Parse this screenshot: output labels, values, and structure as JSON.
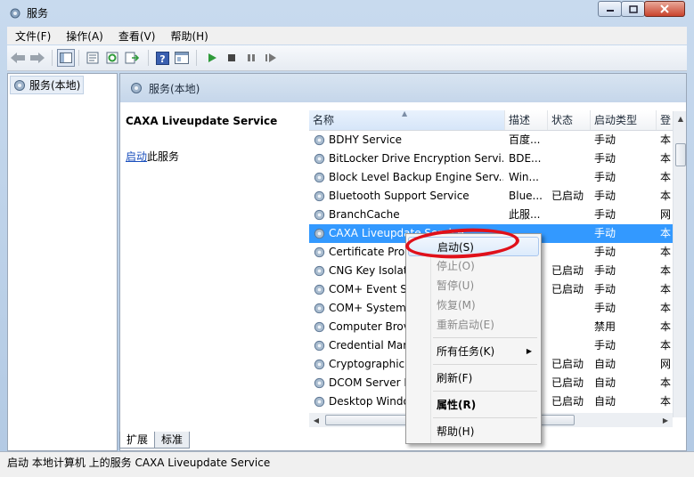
{
  "window": {
    "title": "服务",
    "colors": {
      "title_gradient": "#c8daee",
      "selection": "#3399ff",
      "annotation": "#e0101a"
    }
  },
  "menu": [
    "文件(F)",
    "操作(A)",
    "查看(V)",
    "帮助(H)"
  ],
  "toolbar_icons": [
    "back-icon",
    "forward-icon",
    "show-console-tree-icon",
    "properties-icon",
    "refresh-icon",
    "export-list-icon",
    "help-icon",
    "view-icon",
    "start-icon",
    "stop-icon",
    "pause-icon",
    "resume-icon"
  ],
  "tree": {
    "root": "服务(本地)"
  },
  "panel": {
    "header": "服务(本地)",
    "selected_name": "CAXA Liveupdate Service",
    "action_link": "启动",
    "action_suffix": "此服务"
  },
  "table": {
    "columns": [
      "名称",
      "描述",
      "状态",
      "启动类型",
      "登"
    ],
    "rows": [
      {
        "name": "BDHY Service",
        "desc": "百度...",
        "status": "",
        "startup": "手动",
        "logon": "本"
      },
      {
        "name": "BitLocker Drive Encryption Servi...",
        "desc": "BDE...",
        "status": "",
        "startup": "手动",
        "logon": "本"
      },
      {
        "name": "Block Level Backup Engine Serv...",
        "desc": "Win...",
        "status": "",
        "startup": "手动",
        "logon": "本"
      },
      {
        "name": "Bluetooth Support Service",
        "desc": "Blue...",
        "status": "已启动",
        "startup": "手动",
        "logon": "本"
      },
      {
        "name": "BranchCache",
        "desc": "此服...",
        "status": "",
        "startup": "手动",
        "logon": "网"
      },
      {
        "name": "CAXA Liveupdate Service",
        "desc": "",
        "status": "",
        "startup": "手动",
        "logon": "本"
      },
      {
        "name": "Certificate Prop",
        "desc": "",
        "status": "",
        "startup": "手动",
        "logon": "本"
      },
      {
        "name": "CNG Key Isolat",
        "desc": "",
        "status": "已启动",
        "startup": "手动",
        "logon": "本"
      },
      {
        "name": "COM+ Event Sy",
        "desc": "",
        "status": "已启动",
        "startup": "手动",
        "logon": "本"
      },
      {
        "name": "COM+ System",
        "desc": "",
        "status": "",
        "startup": "手动",
        "logon": "本"
      },
      {
        "name": "Computer Brov",
        "desc": "",
        "status": "",
        "startup": "禁用",
        "logon": "本"
      },
      {
        "name": "Credential Mar",
        "desc": "",
        "status": "",
        "startup": "手动",
        "logon": "本"
      },
      {
        "name": "Cryptographic",
        "desc": "",
        "status": "已启动",
        "startup": "自动",
        "logon": "网"
      },
      {
        "name": "DCOM Server I",
        "desc": "",
        "status": "已启动",
        "startup": "自动",
        "logon": "本"
      },
      {
        "name": "Desktop Windo",
        "desc": "",
        "status": "已启动",
        "startup": "自动",
        "logon": "本"
      }
    ]
  },
  "context_menu": {
    "items": [
      {
        "label": "启动(S)",
        "enabled": true
      },
      {
        "label": "停止(O)",
        "enabled": false
      },
      {
        "label": "暂停(U)",
        "enabled": false
      },
      {
        "label": "恢复(M)",
        "enabled": false
      },
      {
        "label": "重新启动(E)",
        "enabled": false
      },
      {
        "label": "所有任务(K)",
        "enabled": true,
        "submenu": true
      },
      {
        "label": "刷新(F)",
        "enabled": true
      },
      {
        "label": "属性(R)",
        "enabled": true,
        "bold": true
      },
      {
        "label": "帮助(H)",
        "enabled": true
      }
    ]
  },
  "tabs": [
    "扩展",
    "标准"
  ],
  "status_bar": "启动 本地计算机 上的服务 CAXA Liveupdate Service"
}
